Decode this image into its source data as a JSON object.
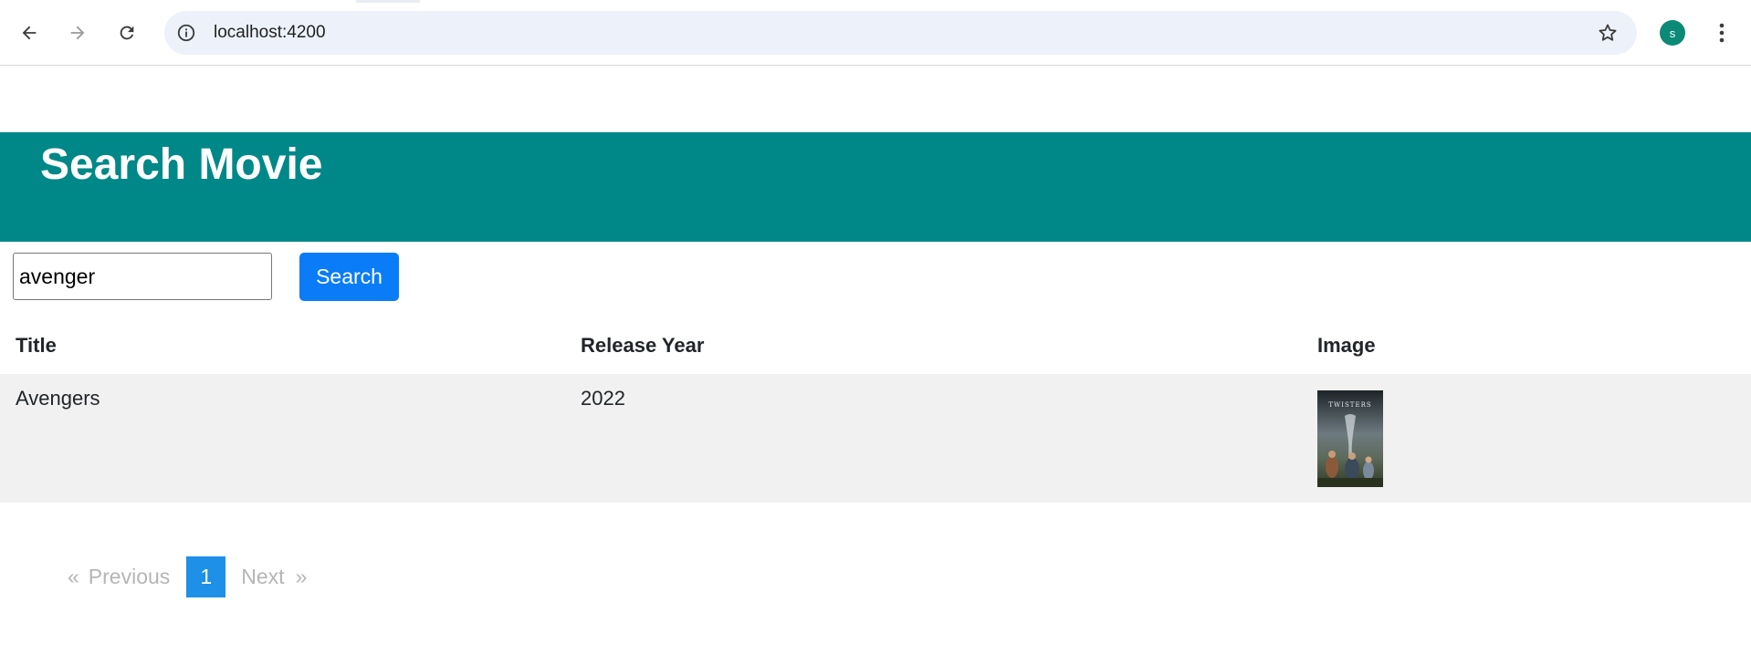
{
  "browser": {
    "url": "localhost:4200",
    "profile_initial": "s"
  },
  "page": {
    "title": "Search Movie"
  },
  "search": {
    "value": "avenger",
    "button_label": "Search"
  },
  "table": {
    "headers": [
      "Title",
      "Release Year",
      "Image"
    ],
    "rows": [
      {
        "title": "Avengers",
        "year": "2022",
        "image_text": "TWISTERS"
      }
    ]
  },
  "pagination": {
    "prev_chevron": "«",
    "prev_label": "Previous",
    "current_page": "1",
    "next_label": "Next",
    "next_chevron": "»"
  },
  "colors": {
    "header_bg": "#008888",
    "button_bg": "#0a7cf7",
    "pagination_active": "#1e90e8",
    "row_bg": "#f1f1f1"
  },
  "icons": [
    "back-icon",
    "forward-icon",
    "reload-icon",
    "info-icon",
    "star-icon",
    "more-vert-icon"
  ]
}
